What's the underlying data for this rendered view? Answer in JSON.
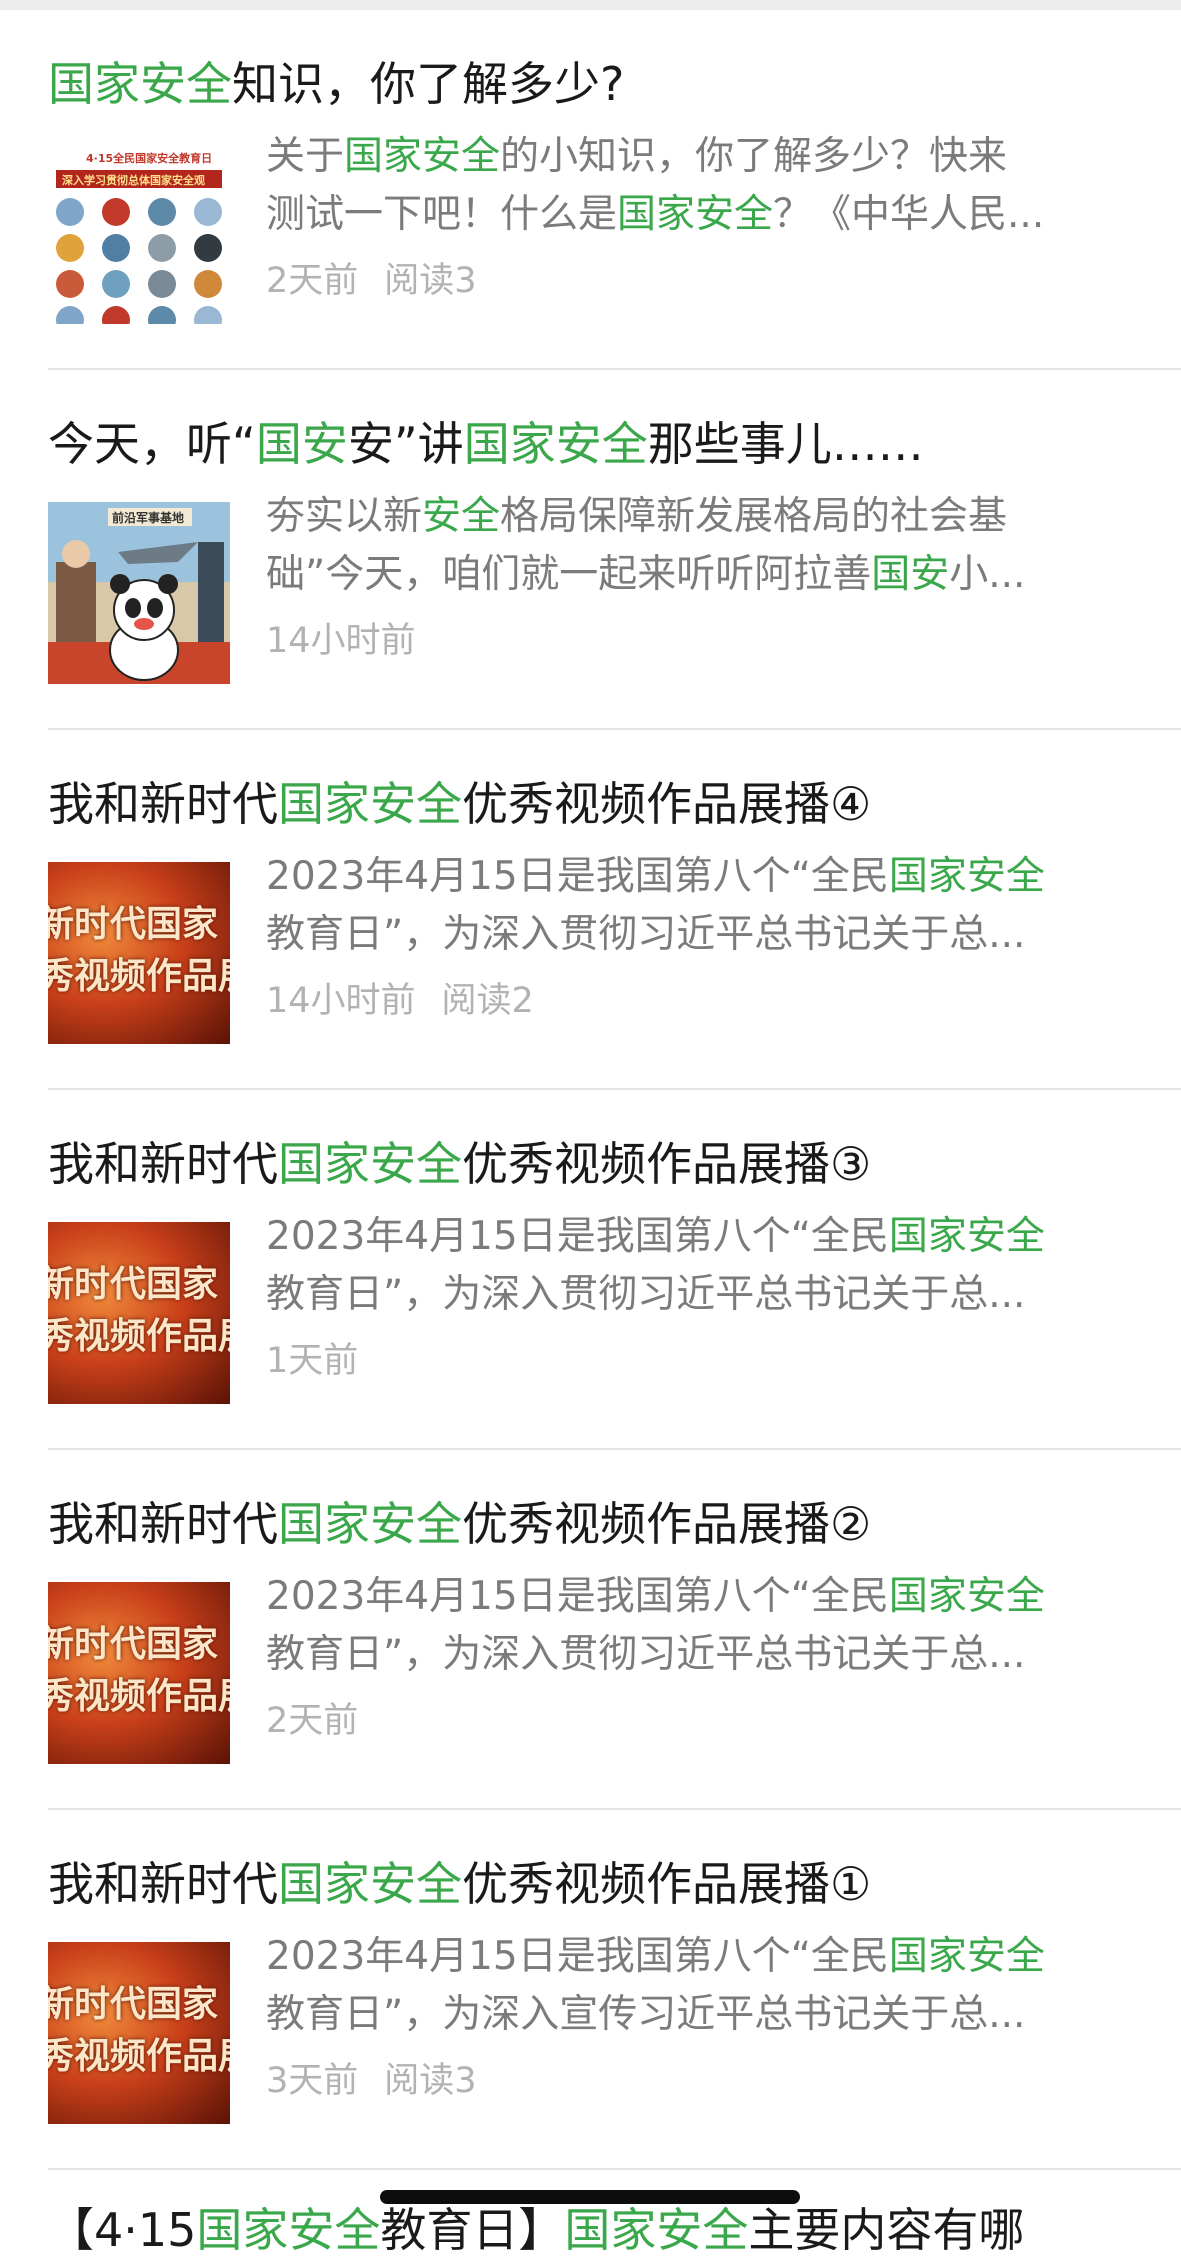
{
  "articles": [
    {
      "title_parts": [
        {
          "text": "国家安全",
          "hl": true
        },
        {
          "text": "知识，你了解多少?",
          "hl": false
        }
      ],
      "snippet_line1": [
        {
          "text": "关于",
          "hl": false
        },
        {
          "text": "国家安全",
          "hl": true
        },
        {
          "text": "的小知识，你了解多少？快来",
          "hl": false
        }
      ],
      "snippet_line2": [
        {
          "text": "测试一下吧！什么是",
          "hl": false
        },
        {
          "text": "国家安全",
          "hl": true
        },
        {
          "text": "？《中华人民...",
          "hl": false
        }
      ],
      "time": "2天前",
      "reads": "阅读3",
      "thumb": "quiz-poster"
    },
    {
      "title_parts": [
        {
          "text": "今天，听“",
          "hl": false
        },
        {
          "text": "国安",
          "hl": true
        },
        {
          "text": "安”讲",
          "hl": false
        },
        {
          "text": "国家安全",
          "hl": true
        },
        {
          "text": "那些事儿……",
          "hl": false
        }
      ],
      "snippet_line1": [
        {
          "text": "夯实以新",
          "hl": false
        },
        {
          "text": "安全",
          "hl": true
        },
        {
          "text": "格局保障新发展格局的社会基",
          "hl": false
        }
      ],
      "snippet_line2": [
        {
          "text": "础”今天，咱们就一起来听听阿拉善",
          "hl": false
        },
        {
          "text": "国安",
          "hl": true
        },
        {
          "text": "小...",
          "hl": false
        }
      ],
      "time": "14小时前",
      "reads": "",
      "thumb": "panda-cartoon"
    },
    {
      "title_parts": [
        {
          "text": "我和新时代",
          "hl": false
        },
        {
          "text": "国家安全",
          "hl": true
        },
        {
          "text": "优秀视频作品展播④",
          "hl": false
        }
      ],
      "snippet_line1": [
        {
          "text": "2023年4月15日是我国第八个“全民",
          "hl": false
        },
        {
          "text": "国家安全",
          "hl": true
        }
      ],
      "snippet_line2": [
        {
          "text": "教育日”，为深入贯彻习近平总书记关于总...",
          "hl": false
        }
      ],
      "time": "14小时前",
      "reads": "阅读2",
      "thumb": "red-video"
    },
    {
      "title_parts": [
        {
          "text": "我和新时代",
          "hl": false
        },
        {
          "text": "国家安全",
          "hl": true
        },
        {
          "text": "优秀视频作品展播③",
          "hl": false
        }
      ],
      "snippet_line1": [
        {
          "text": "2023年4月15日是我国第八个“全民",
          "hl": false
        },
        {
          "text": "国家安全",
          "hl": true
        }
      ],
      "snippet_line2": [
        {
          "text": "教育日”，为深入贯彻习近平总书记关于总...",
          "hl": false
        }
      ],
      "time": "1天前",
      "reads": "",
      "thumb": "red-video"
    },
    {
      "title_parts": [
        {
          "text": "我和新时代",
          "hl": false
        },
        {
          "text": "国家安全",
          "hl": true
        },
        {
          "text": "优秀视频作品展播②",
          "hl": false
        }
      ],
      "snippet_line1": [
        {
          "text": "2023年4月15日是我国第八个“全民",
          "hl": false
        },
        {
          "text": "国家安全",
          "hl": true
        }
      ],
      "snippet_line2": [
        {
          "text": "教育日”，为深入贯彻习近平总书记关于总...",
          "hl": false
        }
      ],
      "time": "2天前",
      "reads": "",
      "thumb": "red-video"
    },
    {
      "title_parts": [
        {
          "text": "我和新时代",
          "hl": false
        },
        {
          "text": "国家安全",
          "hl": true
        },
        {
          "text": "优秀视频作品展播①",
          "hl": false
        }
      ],
      "snippet_line1": [
        {
          "text": "2023年4月15日是我国第八个“全民",
          "hl": false
        },
        {
          "text": "国家安全",
          "hl": true
        }
      ],
      "snippet_line2": [
        {
          "text": "教育日”，为深入宣传习近平总书记关于总...",
          "hl": false
        }
      ],
      "time": "3天前",
      "reads": "阅读3",
      "thumb": "red-video"
    }
  ],
  "partial_next_title": [
    {
      "text": "【4·15",
      "hl": false
    },
    {
      "text": "国家安全",
      "hl": true
    },
    {
      "text": "教育日】",
      "hl": false
    },
    {
      "text": "国家安全",
      "hl": true
    },
    {
      "text": "主要内容有哪",
      "hl": false
    }
  ],
  "thumb_texts": {
    "quiz_line1": "4·15全民国家安全教育日",
    "quiz_line2": "深入学习贯彻总体国家安全观",
    "panda_label": "前沿军事基地",
    "red_line1": "新时代国家",
    "red_line2": "秀视频作品展"
  },
  "colors": {
    "highlight": "#3aa84a",
    "title": "#1a1a1a",
    "snippet": "#7b7b7b",
    "meta": "#b2b2b2",
    "divider": "#e5e5e5"
  }
}
